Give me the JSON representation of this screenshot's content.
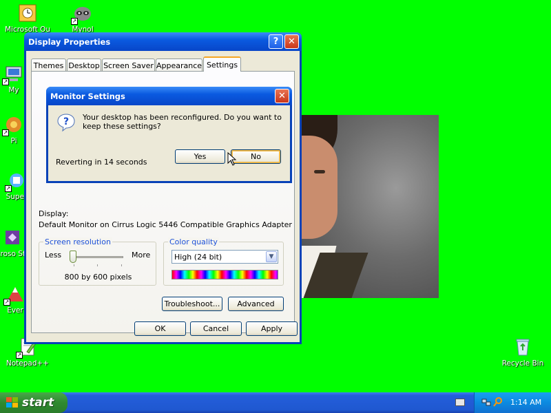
{
  "desktop": {
    "icons": [
      {
        "label": "Microsoft Ou",
        "icon": "outlook-icon"
      },
      {
        "label": "Mynol",
        "icon": "raccoon-icon"
      },
      {
        "label": "My",
        "icon": "my-computer-icon"
      },
      {
        "label": "Pi",
        "icon": "picasa-icon"
      },
      {
        "label": "Super",
        "icon": "super-icon"
      },
      {
        "label": "Microso Studi",
        "icon": "studio-icon"
      },
      {
        "label": "Ever",
        "icon": "everest-icon"
      },
      {
        "label": "Notepad++",
        "icon": "notepadpp-icon"
      },
      {
        "label": "Recycle Bin",
        "icon": "recycle-bin-icon"
      }
    ]
  },
  "display_properties": {
    "title": "Display Properties",
    "help_label": "?",
    "close_label": "✕",
    "tabs": [
      {
        "label": "Themes"
      },
      {
        "label": "Desktop"
      },
      {
        "label": "Screen Saver"
      },
      {
        "label": "Appearance"
      },
      {
        "label": "Settings"
      }
    ],
    "display_label": "Display:",
    "display_value": "Default Monitor on Cirrus Logic 5446 Compatible Graphics Adapter",
    "resolution": {
      "group_label": "Screen resolution",
      "less_label": "Less",
      "more_label": "More",
      "value_text": "800 by 600 pixels",
      "slider_position": 0
    },
    "color_quality": {
      "group_label": "Color quality",
      "selected": "High (24 bit)"
    },
    "troubleshoot_label": "Troubleshoot...",
    "advanced_label": "Advanced",
    "ok_label": "OK",
    "cancel_label": "Cancel",
    "apply_label": "Apply"
  },
  "monitor_settings": {
    "title": "Monitor Settings",
    "close_label": "✕",
    "message": "Your desktop has been reconfigured.  Do you want to keep these settings?",
    "countdown": "Reverting in 14 seconds",
    "yes_label": "Yes",
    "no_label": "No"
  },
  "taskbar": {
    "start_label": "start",
    "clock": "1:14 AM"
  },
  "colors": {
    "desktop_bg": "#00ff00",
    "title_blue": "#0a5ae0",
    "dialog_face": "#ece9d8",
    "group_label_blue": "#1c50d8",
    "start_green": "#2f8a2f"
  }
}
